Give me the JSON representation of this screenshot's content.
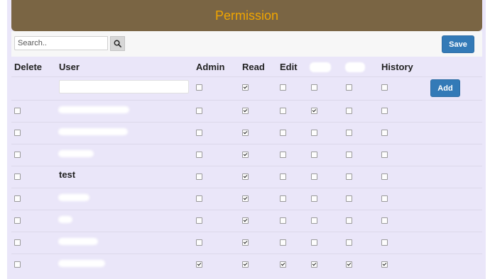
{
  "header": {
    "title": "Permission"
  },
  "toolbar": {
    "search_placeholder": "Search..",
    "save_label": "Save"
  },
  "columns": [
    "Delete",
    "User",
    "Admin",
    "Read",
    "Edit",
    "History"
  ],
  "add_label": "Add",
  "rows": [
    {
      "user": "",
      "delete": false,
      "admin": false,
      "read": true,
      "edit": false,
      "c5": true,
      "c6": false,
      "history": false
    },
    {
      "user": "",
      "delete": false,
      "admin": false,
      "read": true,
      "edit": false,
      "c5": false,
      "c6": false,
      "history": false
    },
    {
      "user": "",
      "delete": false,
      "admin": false,
      "read": true,
      "edit": false,
      "c5": false,
      "c6": false,
      "history": false
    },
    {
      "user": "test",
      "delete": false,
      "admin": false,
      "read": true,
      "edit": false,
      "c5": false,
      "c6": false,
      "history": false
    },
    {
      "user": "",
      "delete": false,
      "admin": false,
      "read": true,
      "edit": false,
      "c5": false,
      "c6": false,
      "history": false
    },
    {
      "user": "",
      "delete": false,
      "admin": false,
      "read": true,
      "edit": false,
      "c5": false,
      "c6": false,
      "history": false
    },
    {
      "user": "",
      "delete": false,
      "admin": false,
      "read": true,
      "edit": false,
      "c5": false,
      "c6": false,
      "history": false
    },
    {
      "user": "",
      "delete": false,
      "admin": true,
      "read": true,
      "edit": true,
      "c5": true,
      "c6": true,
      "history": true
    }
  ]
}
